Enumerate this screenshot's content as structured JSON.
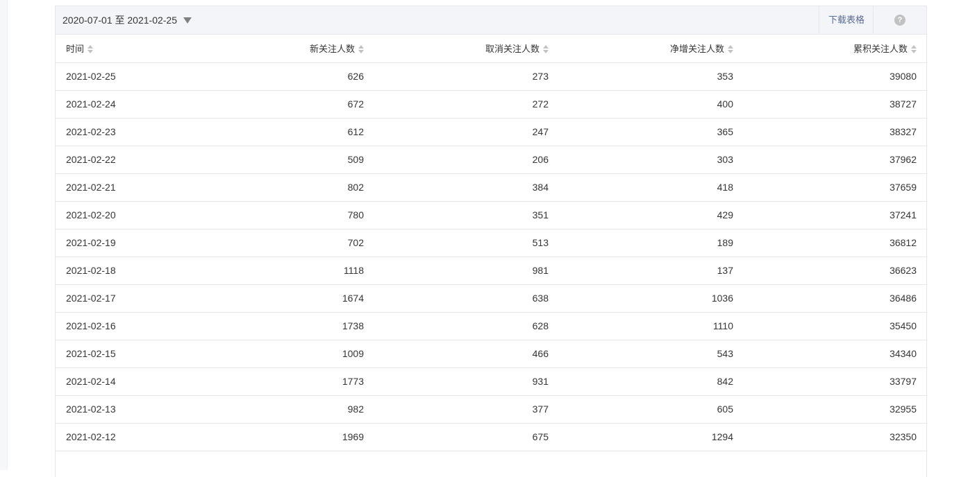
{
  "toolbar": {
    "date_range": "2020-07-01 至 2021-02-25",
    "download_label": "下载表格",
    "help_label": "?"
  },
  "table": {
    "columns": [
      "时间",
      "新关注人数",
      "取消关注人数",
      "净增关注人数",
      "累积关注人数"
    ],
    "rows": [
      [
        "2021-02-25",
        "626",
        "273",
        "353",
        "39080"
      ],
      [
        "2021-02-24",
        "672",
        "272",
        "400",
        "38727"
      ],
      [
        "2021-02-23",
        "612",
        "247",
        "365",
        "38327"
      ],
      [
        "2021-02-22",
        "509",
        "206",
        "303",
        "37962"
      ],
      [
        "2021-02-21",
        "802",
        "384",
        "418",
        "37659"
      ],
      [
        "2021-02-20",
        "780",
        "351",
        "429",
        "37241"
      ],
      [
        "2021-02-19",
        "702",
        "513",
        "189",
        "36812"
      ],
      [
        "2021-02-18",
        "1118",
        "981",
        "137",
        "36623"
      ],
      [
        "2021-02-17",
        "1674",
        "638",
        "1036",
        "36486"
      ],
      [
        "2021-02-16",
        "1738",
        "628",
        "1110",
        "35450"
      ],
      [
        "2021-02-15",
        "1009",
        "466",
        "543",
        "34340"
      ],
      [
        "2021-02-14",
        "1773",
        "931",
        "842",
        "33797"
      ],
      [
        "2021-02-13",
        "982",
        "377",
        "605",
        "32955"
      ],
      [
        "2021-02-12",
        "1969",
        "675",
        "1294",
        "32350"
      ]
    ]
  }
}
